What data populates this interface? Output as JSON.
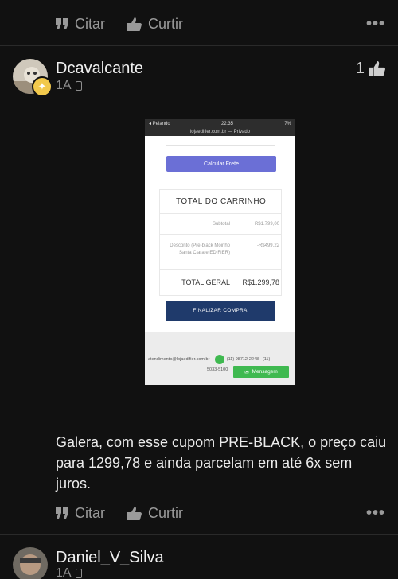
{
  "top_actions": {
    "quote_label": "Citar",
    "like_label": "Curtir",
    "more_label": "•••"
  },
  "post": {
    "username": "Dcavalcante",
    "time_ago": "1A",
    "likes_count": "1",
    "embedded_screenshot": {
      "status_left": "◂ Pelando",
      "status_time": "22:35",
      "status_battery": "7%",
      "url": "lojaedifier.com.br — Privado",
      "calc_button": "Calcular Frete",
      "cart_title": "TOTAL DO CARRINHO",
      "subtotal_label": "Subtotal",
      "subtotal_value": "R$1.799,00",
      "discount_label": "Desconto (Pre-black Moinho Santa Clara e EDIFIER)",
      "discount_value": "-R$499,22",
      "total_label": "TOTAL GERAL",
      "total_value": "R$1.299,78",
      "finish_button": "FINALIZAR COMPRA",
      "contact_email": "atendimento@lojaedifier.com.br ·",
      "contact_phone": "(11) 98712-2248 · (11)",
      "contact_phone2": "5033-5100",
      "message_button": "Mensagem"
    },
    "text": "Galera, com esse cupom PRE-BLACK, o preço caiu para 1299,78 e ainda parcelam em até 6x sem juros."
  },
  "post_actions": {
    "quote_label": "Citar",
    "like_label": "Curtir",
    "more_label": "•••"
  },
  "next_post": {
    "username": "Daniel_V_Silva",
    "time_ago": "1A"
  }
}
